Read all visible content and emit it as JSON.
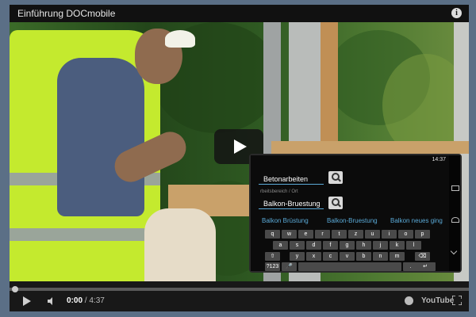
{
  "player": {
    "title": "Einführung DOCmobile",
    "info_icon": "info-icon",
    "current_time": "0:00",
    "time_separator": "/",
    "duration": "4:37",
    "progress": 0,
    "youtube_logo": "YouTube"
  },
  "app": {
    "status_time": "14:37",
    "field1_value": "Betonarbeiten",
    "field1_label": "",
    "field2_label": "rbeitsbereich / Ort",
    "field2_value": "Balkon-Bruestung",
    "suggestions": [
      "Balkon Brüstung",
      "Balkon-Bruestung",
      "Balkon neues ging"
    ],
    "keyboard": {
      "row1": [
        "q",
        "w",
        "e",
        "r",
        "t",
        "z",
        "u",
        "i",
        "o",
        "p"
      ],
      "row2": [
        "a",
        "s",
        "d",
        "f",
        "g",
        "h",
        "j",
        "k",
        "l"
      ],
      "row3": [
        "y",
        "x",
        "c",
        "v",
        "b",
        "n",
        "m"
      ],
      "row4_left": "?123",
      "row4_dot": "."
    }
  }
}
